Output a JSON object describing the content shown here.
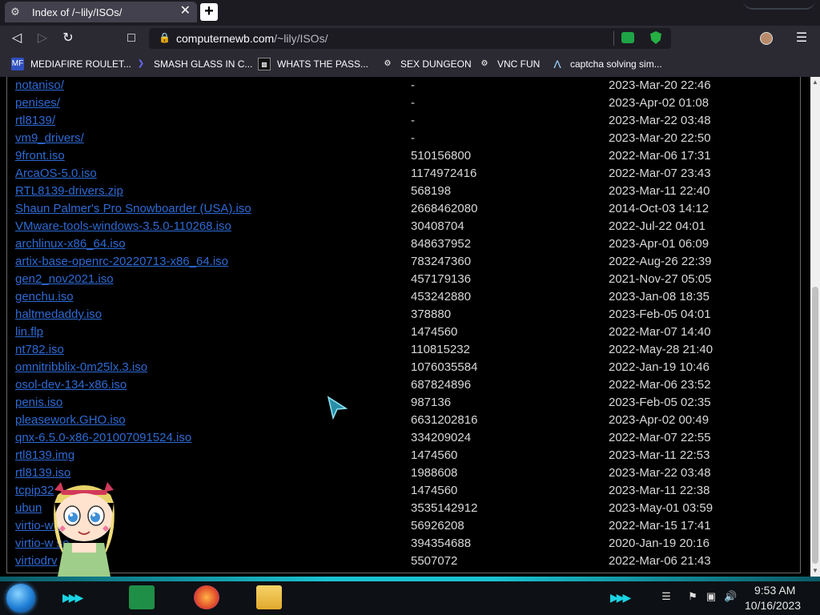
{
  "browser": {
    "tab_title": "Index of /~lily/ISOs/",
    "url_host": "computernewb.com",
    "url_path": "/~lily/ISOs/"
  },
  "bookmarks": [
    {
      "label": "MEDIAFIRE ROULET...",
      "icon": "mediafire-icon"
    },
    {
      "label": "SMASH GLASS IN C...",
      "icon": "bookmark-icon"
    },
    {
      "label": "WHATS THE PASS...",
      "icon": "bookmark-icon"
    },
    {
      "label": "SEX DUNGEON",
      "icon": "bookmark-icon"
    },
    {
      "label": "VNC FUN",
      "icon": "bookmark-icon"
    },
    {
      "label": "captcha solving sim...",
      "icon": "bookmark-icon"
    }
  ],
  "files": [
    {
      "name": "notaniso/",
      "size": "-",
      "date": "2023-Mar-20 22:46"
    },
    {
      "name": "penises/",
      "size": "-",
      "date": "2023-Apr-02 01:08"
    },
    {
      "name": "rtl8139/",
      "size": "-",
      "date": "2023-Mar-22 03:48"
    },
    {
      "name": "vm9_drivers/",
      "size": "-",
      "date": "2023-Mar-20 22:50"
    },
    {
      "name": "9front.iso",
      "size": "510156800",
      "date": "2022-Mar-06 17:31"
    },
    {
      "name": "ArcaOS-5.0.iso",
      "size": "1174972416",
      "date": "2022-Mar-07 23:43"
    },
    {
      "name": "RTL8139-drivers.zip",
      "size": "568198",
      "date": "2023-Mar-11 22:40"
    },
    {
      "name": "Shaun Palmer's Pro Snowboarder (USA).iso",
      "size": "2668462080",
      "date": "2014-Oct-03 14:12"
    },
    {
      "name": "VMware-tools-windows-3.5.0-110268.iso",
      "size": "30408704",
      "date": "2022-Jul-22 04:01"
    },
    {
      "name": "archlinux-x86_64.iso",
      "size": "848637952",
      "date": "2023-Apr-01 06:09"
    },
    {
      "name": "artix-base-openrc-20220713-x86_64.iso",
      "size": "783247360",
      "date": "2022-Aug-26 22:39"
    },
    {
      "name": "gen2_nov2021.iso",
      "size": "457179136",
      "date": "2021-Nov-27 05:05"
    },
    {
      "name": "genchu.iso",
      "size": "453242880",
      "date": "2023-Jan-08 18:35"
    },
    {
      "name": "haltmedaddy.iso",
      "size": "378880",
      "date": "2023-Feb-05 04:01"
    },
    {
      "name": "lin.flp",
      "size": "1474560",
      "date": "2022-Mar-07 14:40"
    },
    {
      "name": "nt782.iso",
      "size": "110815232",
      "date": "2022-May-28 21:40"
    },
    {
      "name": "omnitribblix-0m25lx.3.iso",
      "size": "1076035584",
      "date": "2022-Jan-19 10:46"
    },
    {
      "name": "osol-dev-134-x86.iso",
      "size": "687824896",
      "date": "2022-Mar-06 23:52"
    },
    {
      "name": "penis.iso",
      "size": "987136",
      "date": "2023-Feb-05 02:35"
    },
    {
      "name": "pleasework.GHO.iso",
      "size": "6631202816",
      "date": "2023-Apr-02 00:49"
    },
    {
      "name": "qnx-6.5.0-x86-201007091524.iso",
      "size": "334209024",
      "date": "2022-Mar-07 22:55"
    },
    {
      "name": "rtl8139.img",
      "size": "1474560",
      "date": "2023-Mar-11 22:53"
    },
    {
      "name": "rtl8139.iso",
      "size": "1988608",
      "date": "2023-Mar-22 03:48"
    },
    {
      "name": "tcpip32",
      "size": "1474560",
      "date": "2023-Mar-11 22:38"
    },
    {
      "name": "ubun",
      "size": "3535142912",
      "date": "2023-May-01 03:59"
    },
    {
      "name": "virtio-w                so",
      "size": "56926208",
      "date": "2022-Mar-15 17:41"
    },
    {
      "name": "virtio-w                so",
      "size": "394354688",
      "date": "2020-Jan-19 20:16"
    },
    {
      "name": "virtiodrv",
      "size": "5507072",
      "date": "2022-Mar-06 21:43"
    }
  ],
  "taskbar": {
    "time": "9:53 AM",
    "date": "10/16/2023"
  }
}
